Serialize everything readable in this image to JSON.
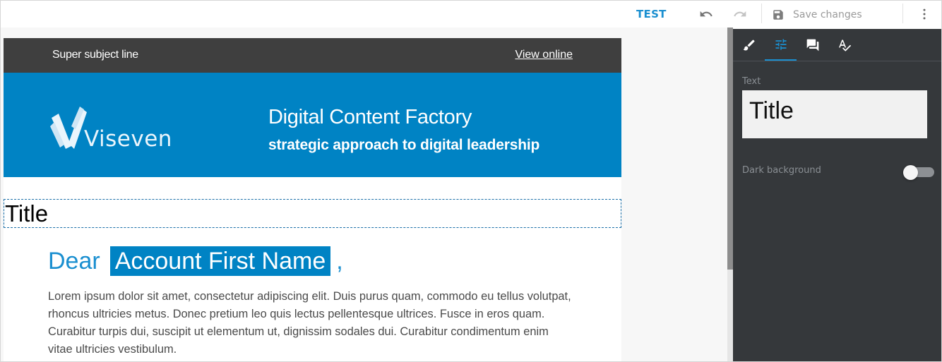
{
  "toolbar": {
    "test_label": "TEST",
    "undo_icon": "undo-icon",
    "redo_icon": "redo-icon",
    "save_label": "Save changes",
    "save_icon": "floppy-disk-icon",
    "more_icon": "more-vertical-icon"
  },
  "email": {
    "subject": "Super subject line",
    "view_online": "View online",
    "logo_text": "Viseven",
    "banner_title": "Digital Content Factory",
    "banner_subtitle": "strategic approach to digital leadership",
    "title": "Title",
    "greeting_prefix": "Dear",
    "greeting_name": "Account First Name",
    "greeting_suffix": ",",
    "body_text": "Lorem ipsum dolor sit amet, consectetur adipiscing elit. Duis purus quam, commodo eu tellus volutpat, rhoncus ultricies metus. Donec pretium leo quis lectus pellentesque ultrices. Fusce in eros quam. Curabitur turpis dui, suscipit ut elementum ut, dignissim sodales dui. Curabitur condimentum enim vitae ultricies vestibulum."
  },
  "panel": {
    "tabs": [
      {
        "icon": "paint-brush-icon",
        "active": false
      },
      {
        "icon": "sliders-icon",
        "active": true
      },
      {
        "icon": "comment-icon",
        "active": false
      },
      {
        "icon": "spellcheck-icon",
        "active": false
      }
    ],
    "text_label": "Text",
    "text_value": "Title",
    "dark_background_label": "Dark background",
    "dark_background_on": false
  },
  "colors": {
    "accent": "#1a8fd0",
    "banner": "#0083c4",
    "preheader": "#3f3f3f",
    "panel": "#35383b"
  }
}
